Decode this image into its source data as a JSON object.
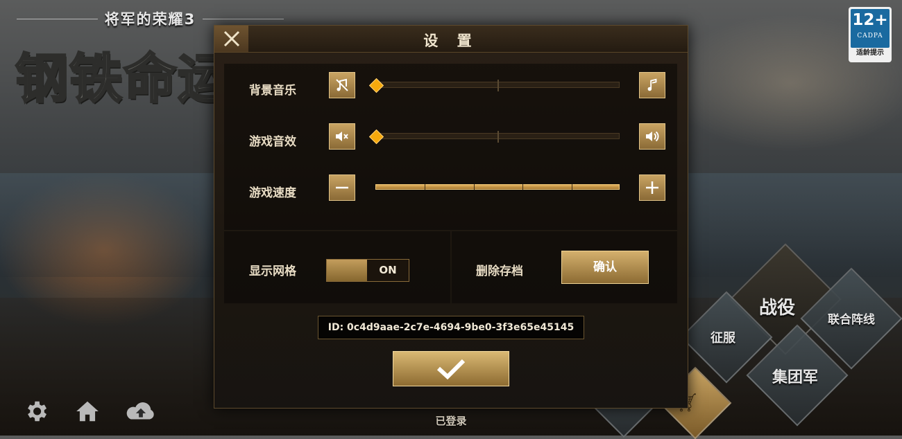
{
  "logo": {
    "subtitle": "将军的荣耀3",
    "title": "钢铁命运"
  },
  "age_rating": {
    "number": "12+",
    "org": "CADPA",
    "tip": "适龄提示"
  },
  "menu": {
    "campaign": "战役",
    "conquest": "征服",
    "alliance": "联合阵线",
    "army_group": "集团军"
  },
  "settings": {
    "title": "设 置",
    "close_icon": "close-icon",
    "bgm": {
      "label": "背景音乐",
      "level": 0.0
    },
    "sfx": {
      "label": "游戏音效",
      "level": 0.0
    },
    "speed": {
      "label": "游戏速度",
      "level": 1.0,
      "segments": 5
    },
    "grid": {
      "label": "显示网格",
      "state": "ON"
    },
    "delete_save": {
      "label": "删除存档",
      "button": "确认"
    },
    "id_text": "ID: 0c4d9aae-2c7e-4694-9be0-3f3e65e45145",
    "ok_icon": "checkmark-icon"
  },
  "status": {
    "logged_in": "已登录"
  },
  "colors": {
    "accent_gold": "#c9a463",
    "knob": "#f6a90d",
    "panel_bg": "#1d1710"
  }
}
